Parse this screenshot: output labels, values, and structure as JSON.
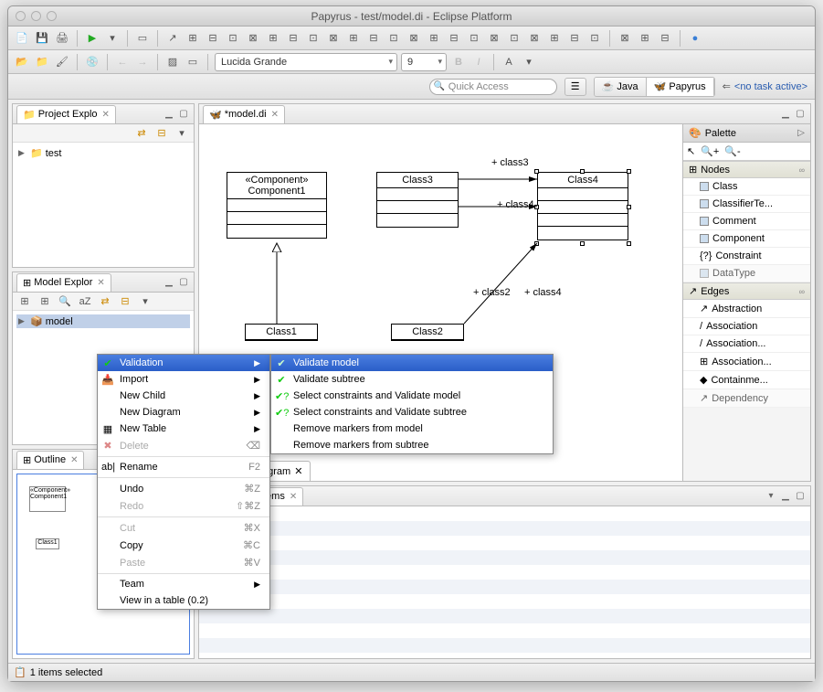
{
  "window": {
    "title": "Papyrus - test/model.di - Eclipse Platform"
  },
  "toolbar2": {
    "font": "Lucida Grande",
    "size": "9"
  },
  "quick": {
    "placeholder": "Quick Access",
    "persp_java": "Java",
    "persp_papyrus": "Papyrus",
    "task": "<no task active>"
  },
  "project_explorer": {
    "title": "Project Explo",
    "item": "test"
  },
  "model_explorer": {
    "title": "Model Explor",
    "item": "model"
  },
  "outline": {
    "title": "Outline"
  },
  "editor": {
    "tab": "*model.di",
    "comp_stereo": "«Component»",
    "comp_name": "Component1",
    "class1": "Class1",
    "class2": "Class2",
    "class3": "Class3",
    "class4": "Class4",
    "lbl_class2": "+ class2",
    "lbl_class3": "+ class3",
    "lbl_class4a": "+ class4",
    "lbl_class4b": "+ class4",
    "inner_tab": "agram"
  },
  "palette": {
    "title": "Palette",
    "cat_nodes": "Nodes",
    "nodes": [
      "Class",
      "ClassifierTe...",
      "Comment",
      "Component",
      "Constraint",
      "DataType"
    ],
    "cat_edges": "Edges",
    "edges": [
      "Abstraction",
      "Association",
      "Association...",
      "Association...",
      "Containme...",
      "Dependency"
    ]
  },
  "bottom": {
    "tab_props": "s",
    "tab_problems": "Problems"
  },
  "ctx_main": {
    "validation": "Validation",
    "import": "Import",
    "new_child": "New Child",
    "new_diagram": "New Diagram",
    "new_table": "New Table",
    "delete": "Delete",
    "rename": "Rename",
    "undo": "Undo",
    "redo": "Redo",
    "cut": "Cut",
    "copy": "Copy",
    "paste": "Paste",
    "team": "Team",
    "view_table": "View in a table (0.2)",
    "k_delete": "⌫",
    "k_rename": "F2",
    "k_undo": "⌘Z",
    "k_redo": "⇧⌘Z",
    "k_cut": "⌘X",
    "k_copy": "⌘C",
    "k_paste": "⌘V"
  },
  "ctx_sub": {
    "validate_model": "Validate model",
    "validate_subtree": "Validate subtree",
    "sel_model": "Select constraints and Validate model",
    "sel_subtree": "Select constraints and Validate subtree",
    "rem_model": "Remove markers from model",
    "rem_subtree": "Remove markers from subtree"
  },
  "status": {
    "text": "1 items selected"
  }
}
